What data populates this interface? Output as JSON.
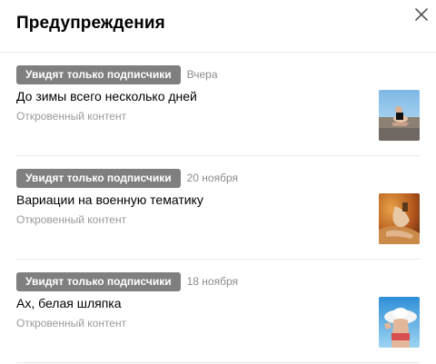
{
  "header": {
    "title": "Предупреждения",
    "close_icon": "close-icon"
  },
  "items": [
    {
      "badge": "Увидят только подписчики",
      "date": "Вчера",
      "title": "До зимы всего несколько дней",
      "subtitle": "Откровенный контент",
      "thumb_icon": "beach-photo-thumbnail"
    },
    {
      "badge": "Увидят только подписчики",
      "date": "20 ноября",
      "title": "Вариации на военную тематику",
      "subtitle": "Откровенный контент",
      "thumb_icon": "desert-photo-thumbnail"
    },
    {
      "badge": "Увидят только подписчики",
      "date": "18 ноября",
      "title": "Ах, белая шляпка",
      "subtitle": "Откровенный контент",
      "thumb_icon": "hat-photo-thumbnail"
    }
  ],
  "colors": {
    "badge_bg": "#7f7f7f",
    "divider": "#e8e8e8",
    "muted_text": "#9a9a9a"
  }
}
